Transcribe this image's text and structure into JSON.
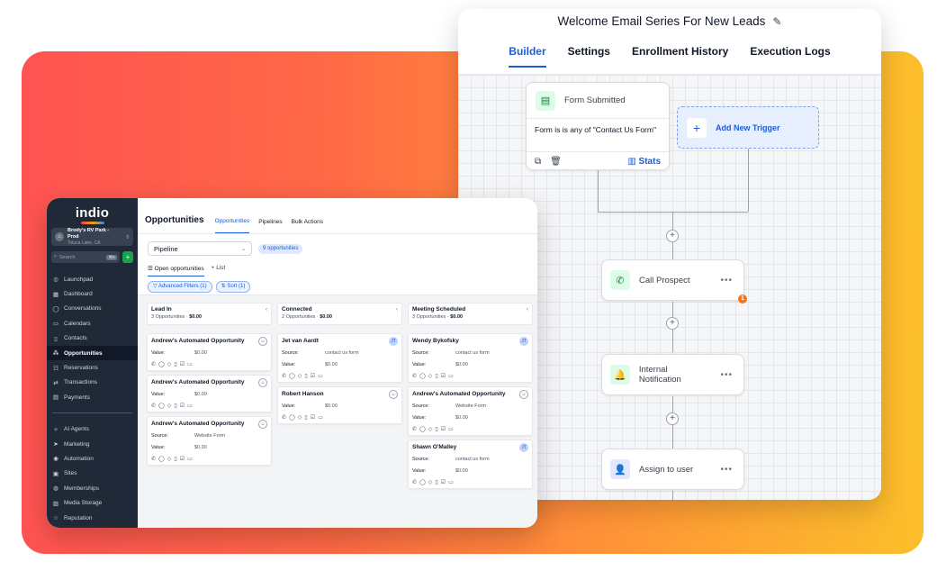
{
  "workflow": {
    "title": "Welcome Email Series For New Leads",
    "tabs": [
      {
        "label": "Builder",
        "active": true
      },
      {
        "label": "Settings",
        "active": false
      },
      {
        "label": "Enrollment History",
        "active": false
      },
      {
        "label": "Execution Logs",
        "active": false
      }
    ],
    "trigger": {
      "title": "Form Submitted",
      "condition": "Form is is any of \"Contact Us Form\"",
      "stats_label": "Stats"
    },
    "add_trigger_label": "Add New Trigger",
    "actions": [
      {
        "label": "Call Prospect",
        "icon": "phone-icon"
      },
      {
        "label": "Internal Notification",
        "icon": "bell-icon"
      },
      {
        "label": "Assign to user",
        "icon": "user-icon"
      }
    ],
    "error_count": "1"
  },
  "crm": {
    "brand": "indio",
    "location": {
      "name": "Brody's RV Park - Prod",
      "sub": "Toluca Lake, CA"
    },
    "search": {
      "placeholder": "Search",
      "shortcut": "⌘K"
    },
    "nav": [
      {
        "label": "Launchpad",
        "icon": "rocket-icon",
        "active": false
      },
      {
        "label": "Dashboard",
        "icon": "dashboard-icon",
        "active": false
      },
      {
        "label": "Conversations",
        "icon": "chat-icon",
        "active": false
      },
      {
        "label": "Calendars",
        "icon": "calendar-icon",
        "active": false
      },
      {
        "label": "Contacts",
        "icon": "contacts-icon",
        "active": false
      },
      {
        "label": "Opportunities",
        "icon": "opportunities-icon",
        "active": true
      },
      {
        "label": "Reservations",
        "icon": "reservations-icon",
        "active": false
      },
      {
        "label": "Transactions",
        "icon": "transactions-icon",
        "active": false
      },
      {
        "label": "Payments",
        "icon": "payments-icon",
        "active": false
      }
    ],
    "nav2": [
      {
        "label": "AI Agents",
        "icon": "sparkle-icon"
      },
      {
        "label": "Marketing",
        "icon": "send-icon"
      },
      {
        "label": "Automation",
        "icon": "automation-icon"
      },
      {
        "label": "Sites",
        "icon": "sites-icon"
      },
      {
        "label": "Memberships",
        "icon": "membership-icon"
      },
      {
        "label": "Media Storage",
        "icon": "media-icon"
      },
      {
        "label": "Reputation",
        "icon": "star-icon"
      }
    ],
    "page_title": "Opportunities",
    "tabs": [
      {
        "label": "Opportunities",
        "active": true
      },
      {
        "label": "Pipelines",
        "active": false
      },
      {
        "label": "Bulk Actions",
        "active": false
      }
    ],
    "pipeline_select": "Pipeline",
    "opportunity_count": "9 opportunities",
    "view_tabs": {
      "open": "Open opportunities",
      "list": "List"
    },
    "filters": {
      "advanced": "Advanced Filters (1)",
      "sort": "Sort (1)"
    },
    "columns": [
      {
        "name": "Lead In",
        "count": "3 Opportunities",
        "sum": "$0.00",
        "cards": [
          {
            "title": "Andrew's Automated Opportunity",
            "avatar": "",
            "rows": [
              {
                "k": "Value:",
                "v": "$0.00"
              }
            ]
          },
          {
            "title": "Andrew's Automated Opportunity",
            "avatar": "",
            "rows": [
              {
                "k": "Value:",
                "v": "$0.00"
              }
            ]
          },
          {
            "title": "Andrew's Automated Opportunity",
            "avatar": "",
            "rows": [
              {
                "k": "Source:",
                "v": "Website Form"
              },
              {
                "k": "Value:",
                "v": "$0.00"
              }
            ]
          }
        ]
      },
      {
        "name": "Connected",
        "count": "2 Opportunities",
        "sum": "$0.00",
        "cards": [
          {
            "title": "Jet van Aardt",
            "avatar": "JT",
            "rows": [
              {
                "k": "Source:",
                "v": "contact us form"
              },
              {
                "k": "Value:",
                "v": "$0.00"
              }
            ]
          },
          {
            "title": "Robert Hanson",
            "avatar": "",
            "rows": [
              {
                "k": "Value:",
                "v": "$0.00"
              }
            ]
          }
        ]
      },
      {
        "name": "Meeting Scheduled",
        "count": "3 Opportunities",
        "sum": "$0.00",
        "cards": [
          {
            "title": "Wendy Bykofsky",
            "avatar": "JT",
            "rows": [
              {
                "k": "Source:",
                "v": "contact us form"
              },
              {
                "k": "Value:",
                "v": "$0.00"
              }
            ]
          },
          {
            "title": "Andrew's Automated Opportunity",
            "avatar": "",
            "rows": [
              {
                "k": "Source:",
                "v": "Website Form"
              },
              {
                "k": "Value:",
                "v": "$0.00"
              }
            ]
          },
          {
            "title": "Shawn O'Malley",
            "avatar": "JT",
            "rows": [
              {
                "k": "Source:",
                "v": "contact us form"
              },
              {
                "k": "Value:",
                "v": "$0.00"
              }
            ]
          }
        ]
      }
    ]
  }
}
